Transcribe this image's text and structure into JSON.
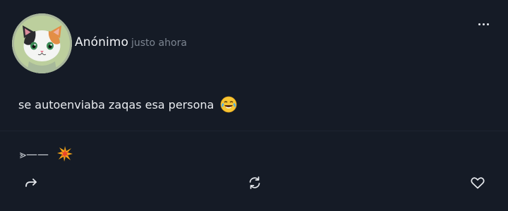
{
  "post": {
    "author": "Anónimo",
    "timestamp": "justo ahora",
    "text": "se autoenviaba zaqas esa persona",
    "text_emoji": "face-with-tears-of-joy-icon",
    "tagline": "⪢——",
    "tagline_emoji": "collision-icon"
  },
  "icons": {
    "more": "more-horizontal-icon",
    "share": "share-arrow-icon",
    "repost": "repost-icon",
    "like": "heart-icon"
  },
  "colors": {
    "background": "#151b26",
    "text": "#e9ecf0",
    "muted": "#7c8591",
    "avatar_bg": "#bccf9d"
  }
}
